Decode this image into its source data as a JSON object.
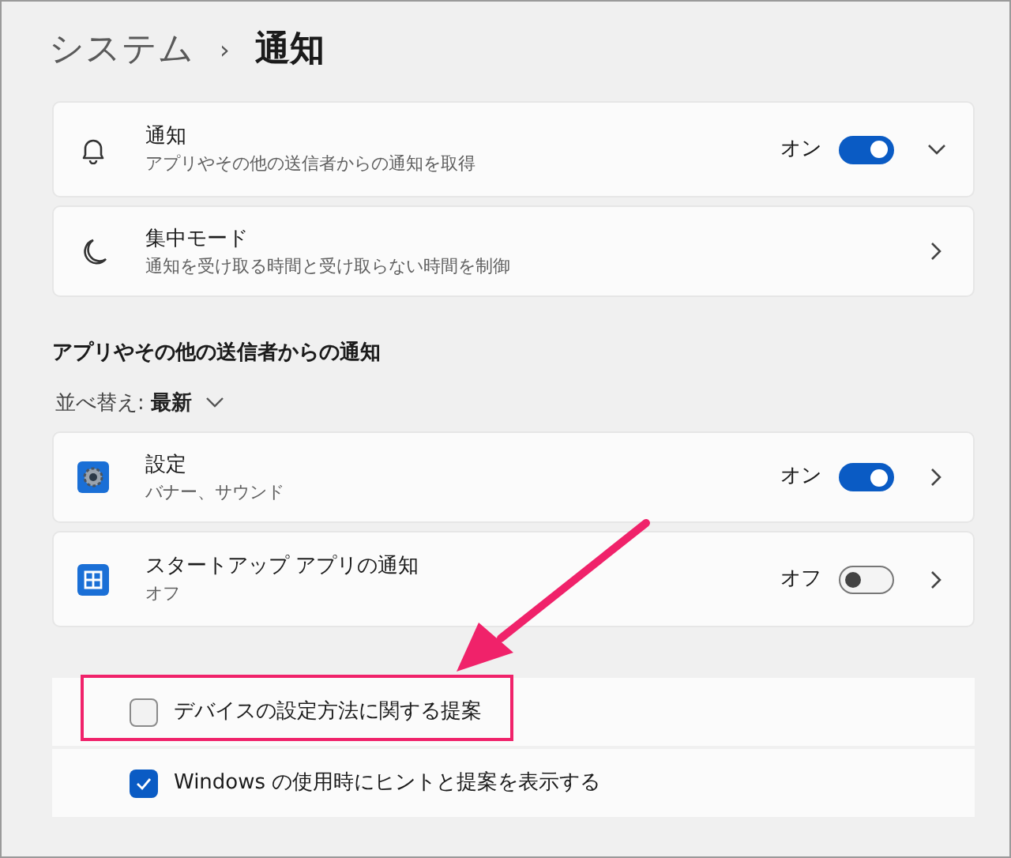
{
  "breadcrumb": {
    "parent": "システム",
    "separator": "›",
    "current": "通知"
  },
  "top_settings": [
    {
      "kind": "expander",
      "title": "通知",
      "subtitle": "アプリやその他の送信者からの通知を取得",
      "toggle": {
        "label": "オン",
        "on": true
      }
    },
    {
      "kind": "link",
      "title": "集中モード",
      "subtitle": "通知を受け取る時間と受け取らない時間を制御"
    }
  ],
  "apps_section": {
    "heading": "アプリやその他の送信者からの通知",
    "sort": {
      "label": "並べ替え:",
      "value": "最新"
    },
    "apps": [
      {
        "kind": "link",
        "title": "設定",
        "subtitle": "バナー、サウンド",
        "toggle": {
          "label": "オン",
          "on": true
        }
      },
      {
        "kind": "link",
        "title": "スタートアップ アプリの通知",
        "subtitle": "オフ",
        "toggle": {
          "label": "オフ",
          "on": false
        }
      }
    ]
  },
  "options": [
    {
      "label": "デバイスの設定方法に関する提案",
      "checked": false,
      "highlighted": true
    },
    {
      "label": "Windows の使用時にヒントと提案を表示する",
      "checked": true,
      "highlighted": false
    }
  ]
}
